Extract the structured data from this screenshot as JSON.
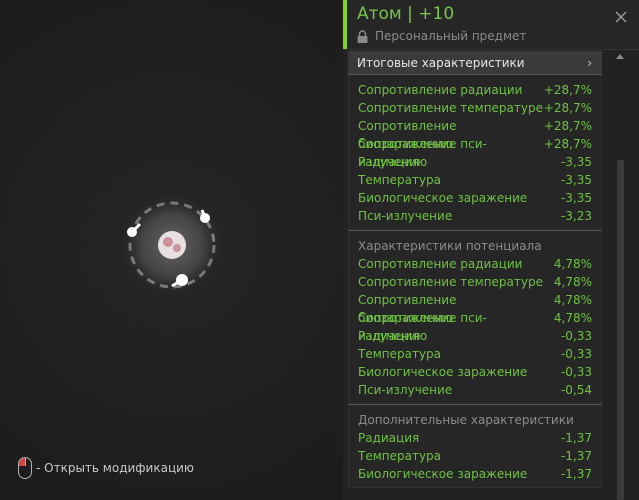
{
  "hint": {
    "text": "- Открыть модификацию"
  },
  "item": {
    "title": "Атом | +10",
    "subtitle": "Персональный предмет"
  },
  "summary": {
    "label": "Итоговые характеристики",
    "rows": [
      {
        "name": "Сопротивление радиации",
        "value": "+28,7%"
      },
      {
        "name": "Сопротивление температуре",
        "value": "+28,7%"
      },
      {
        "name": "Сопротивление биозаражению",
        "value": "+28,7%"
      },
      {
        "name": "Сопротивление пси-излучению",
        "value": "+28,7%"
      },
      {
        "name": "Радиация",
        "value": "-3,35"
      },
      {
        "name": "Температура",
        "value": "-3,35"
      },
      {
        "name": "Биологическое заражение",
        "value": "-3,35"
      },
      {
        "name": "Пси-излучение",
        "value": "-3,23"
      }
    ]
  },
  "potential": {
    "title": "Характеристики потенциала",
    "rows": [
      {
        "name": "Сопротивление радиации",
        "value": "4,78%"
      },
      {
        "name": "Сопротивление температуре",
        "value": "4,78%"
      },
      {
        "name": "Сопротивление биозаражению",
        "value": "4,78%"
      },
      {
        "name": "Сопротивление пси-излучению",
        "value": "4,78%"
      },
      {
        "name": "Радиация",
        "value": "-0,33"
      },
      {
        "name": "Температура",
        "value": "-0,33"
      },
      {
        "name": "Биологическое заражение",
        "value": "-0,33"
      },
      {
        "name": "Пси-излучение",
        "value": "-0,54"
      }
    ]
  },
  "extra": {
    "title": "Дополнительные характеристики",
    "rows": [
      {
        "name": "Радиация",
        "value": "-1,37"
      },
      {
        "name": "Температура",
        "value": "-1,37"
      },
      {
        "name": "Биологическое заражение",
        "value": "-1,37"
      }
    ]
  },
  "colors": {
    "accent": "#7ed321",
    "positive": "#6fc240",
    "muted": "#8a8a8a"
  },
  "icons": [
    "mouse-icon",
    "lock-icon",
    "close-icon",
    "chevron-right-icon",
    "artifact-icon"
  ]
}
